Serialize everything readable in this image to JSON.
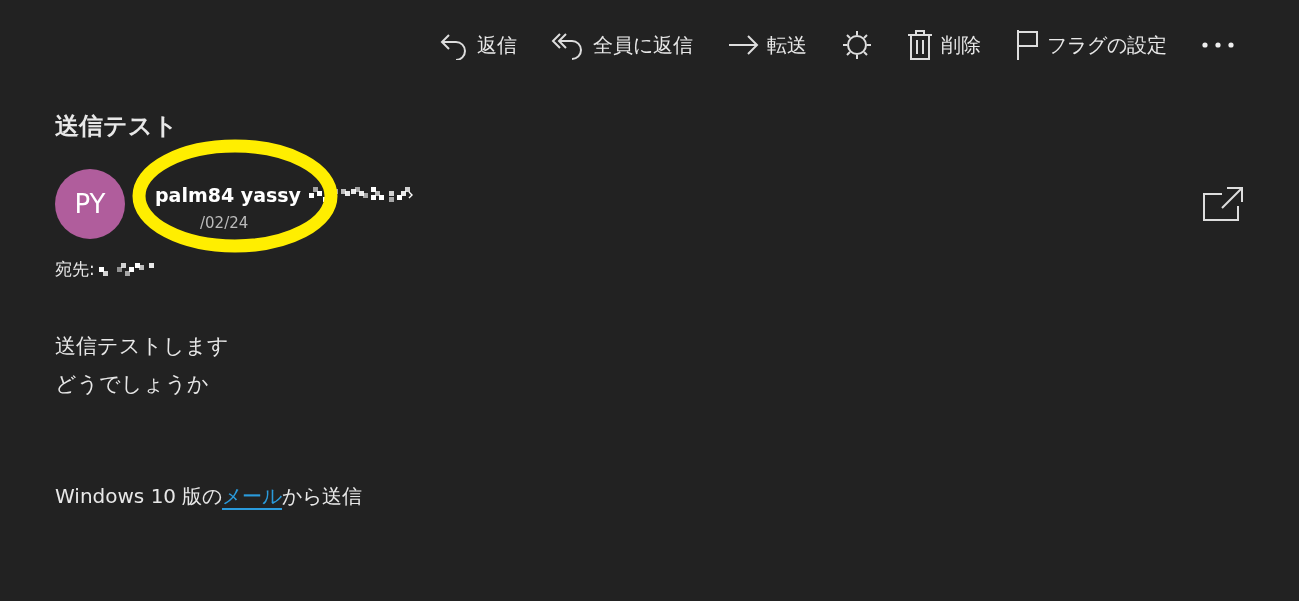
{
  "toolbar": [
    {
      "kind": "reply",
      "label": "返信"
    },
    {
      "kind": "reply-all",
      "label": "全員に返信"
    },
    {
      "kind": "forward",
      "label": "転送"
    },
    {
      "kind": "sun"
    },
    {
      "kind": "delete",
      "label": "削除"
    },
    {
      "kind": "flag",
      "label": "フラグの設定"
    },
    {
      "kind": "more"
    }
  ],
  "message": {
    "subject": "送信テスト",
    "sender": {
      "initials": "PY",
      "name": "palm84 yassy",
      "date": "/02/24"
    },
    "to_label": "宛先:",
    "body": [
      "送信テストします",
      "どうでしょうか"
    ],
    "signature": {
      "before": "Windows 10 版の",
      "link": "メール",
      "after": "から送信"
    }
  }
}
